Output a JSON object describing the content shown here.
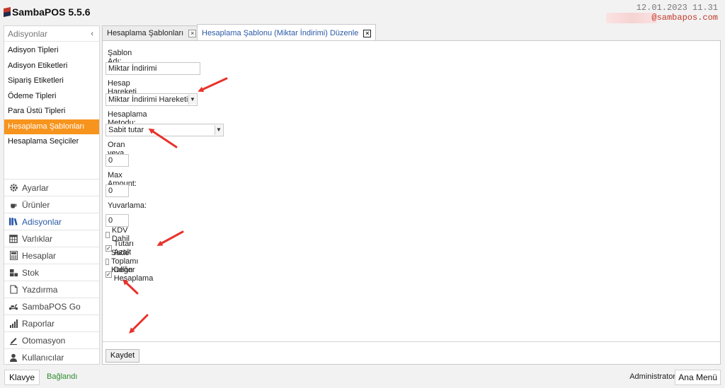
{
  "app": {
    "title": "SambaPOS 5.5.6",
    "datetime": "12.01.2023 11.31",
    "user_email": "@sambapos.com",
    "brand_color": "#c0392b"
  },
  "sidebar": {
    "header": "Adisyonlar",
    "collapse_icon": "‹",
    "items": [
      {
        "label": "Adisyon Tipleri"
      },
      {
        "label": "Adisyon Etiketleri"
      },
      {
        "label": "Sipariş Etiketleri"
      },
      {
        "label": "Ödeme Tipleri"
      },
      {
        "label": "Para Üstü Tipleri"
      },
      {
        "label": "Hesaplama Şablonları"
      },
      {
        "label": "Hesaplama Seçiciler"
      }
    ],
    "active_index": 5,
    "active_color": "#f7941d",
    "nav": [
      {
        "label": "Ayarlar",
        "icon": "gear-icon"
      },
      {
        "label": "Ürünler",
        "icon": "coffee-icon"
      },
      {
        "label": "Adisyonlar",
        "icon": "books-icon"
      },
      {
        "label": "Varlıklar",
        "icon": "table-icon"
      },
      {
        "label": "Hesaplar",
        "icon": "calculator-icon"
      },
      {
        "label": "Stok",
        "icon": "boxes-icon"
      },
      {
        "label": "Yazdırma",
        "icon": "document-icon"
      },
      {
        "label": "SambaPOS Go",
        "icon": "scooter-icon"
      },
      {
        "label": "Raporlar",
        "icon": "bar-chart-icon"
      },
      {
        "label": "Otomasyon",
        "icon": "pen-icon"
      },
      {
        "label": "Kullanıcılar",
        "icon": "user-icon"
      }
    ]
  },
  "tabs": [
    {
      "label": "Hesaplama Şablonları",
      "close": "×"
    },
    {
      "label": "Hesaplama Şablonu (Miktar İndirimi) Düzenle",
      "close": "×"
    }
  ],
  "form": {
    "name_label": "Şablon Adı:",
    "name_value": "Miktar İndirimi",
    "account_tx_label": "Hesap Hareketi Tipi:",
    "account_tx_value": "Miktar İndirimi Hareketi",
    "method_label": "Hesaplama Metodu:",
    "method_value": "Sabit tutar",
    "amount_label": "Oran veya Tutar:",
    "amount_value": "0",
    "max_amount_label": "Max Amount:",
    "max_amount_value": "0",
    "rounding_label": "Yuvarlama:",
    "rounding_value": "0",
    "checkboxes": [
      {
        "label": "KDV Dahil",
        "checked": false,
        "mark": ""
      },
      {
        "label": "Tutarı Azalt",
        "checked": true,
        "mark": "✓"
      },
      {
        "label": "Sade Toplamı Kullan",
        "checked": false,
        "mark": ""
      },
      {
        "label": "Değer Hesaplama",
        "checked": true,
        "mark": "✓"
      }
    ],
    "save_label": "Kaydet"
  },
  "status": {
    "keyboard_label": "Klavye",
    "connection": "Bağlandı",
    "user": "Administrator",
    "main_menu_label": "Ana Menü"
  }
}
